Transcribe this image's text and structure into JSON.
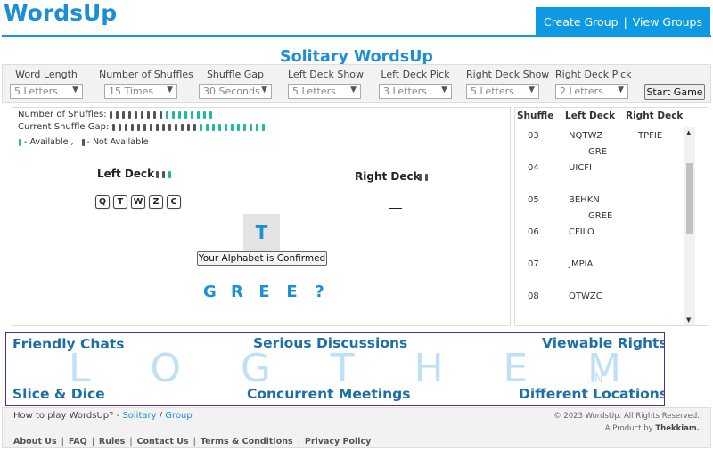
{
  "header": {
    "brand": "WordsUp",
    "nav_create": "Create Group",
    "nav_sep": "|",
    "nav_view": "View Groups"
  },
  "page_title": "Solitary WordsUp",
  "controls": [
    {
      "label": "Word Length",
      "value": "5 Letters"
    },
    {
      "label": "Number of Shuffles",
      "value": "15 Times"
    },
    {
      "label": "Shuffle Gap",
      "value": "30 Seconds"
    },
    {
      "label": "Left Deck Show",
      "value": "5 Letters"
    },
    {
      "label": "Left Deck Pick",
      "value": "3 Letters"
    },
    {
      "label": "Right Deck Show",
      "value": "5 Letters"
    },
    {
      "label": "Right Deck Pick",
      "value": "2 Letters"
    }
  ],
  "start_button": "Start Game",
  "game": {
    "shuffles_label": "Number of Shuffles:",
    "shuffles_not_available": 9,
    "shuffles_available": 8,
    "gap_label": "Current Shuffle Gap:",
    "gap_not_available": 14,
    "gap_available": 11,
    "legend_available": "- Available ,",
    "legend_not_available": "- Not Available",
    "left_deck_label": "Left Deck",
    "left_deck_not_available": 2,
    "left_deck_available": 1,
    "left_deck_letters": [
      "Q",
      "T",
      "W",
      "Z",
      "C"
    ],
    "right_deck_label": "Right Deck",
    "right_deck_not_available": 2,
    "current_tile": "T",
    "confirm_button": "Your Alphabet is Confirmed",
    "guess": [
      "G",
      "R",
      "E",
      "E",
      "?"
    ],
    "colors": {
      "available": "#1abc9c",
      "not_available": "#555555",
      "accent": "#1a8fd8"
    }
  },
  "history": {
    "headers": {
      "shuffle": "Shuffle",
      "left": "Left Deck",
      "right": "Right Deck"
    },
    "rows": [
      {
        "shuffle": "03",
        "left": "NQTWZ",
        "right": "TPFIE",
        "sub": "GRE"
      },
      {
        "shuffle": "04",
        "left": "UICFI",
        "right": "",
        "sub": ""
      },
      {
        "shuffle": "05",
        "left": "BEHKN",
        "right": "",
        "sub": "GREE"
      },
      {
        "shuffle": "06",
        "left": "CFILO",
        "right": "",
        "sub": ""
      },
      {
        "shuffle": "07",
        "left": "JMPIA",
        "right": "",
        "sub": ""
      },
      {
        "shuffle": "08",
        "left": "QTWZC",
        "right": "",
        "sub": ""
      }
    ]
  },
  "banner": {
    "letters": [
      "L",
      "O",
      "G",
      "T",
      "H",
      "E",
      "M"
    ],
    "suffix": ".IN",
    "p1": "Friendly Chats",
    "p2": "Serious Discussions",
    "p3": "Viewable Rights",
    "p4": "Slice & Dice",
    "p5": "Concurrent Meetings",
    "p6": "Different Locations"
  },
  "footer": {
    "howto_prefix": "How to play WordsUp? -",
    "howto_solitary": "Solitary",
    "howto_slash": "/",
    "howto_group": "Group",
    "copyright": "© 2023 WordsUp. All Rights Reserved.",
    "product_prefix": "A Product by",
    "product_name": "Thekkiam.",
    "links": [
      "About Us",
      "FAQ",
      "Rules",
      "Contact Us",
      "Terms & Conditions",
      "Privacy Policy"
    ],
    "link_sep": "|"
  }
}
